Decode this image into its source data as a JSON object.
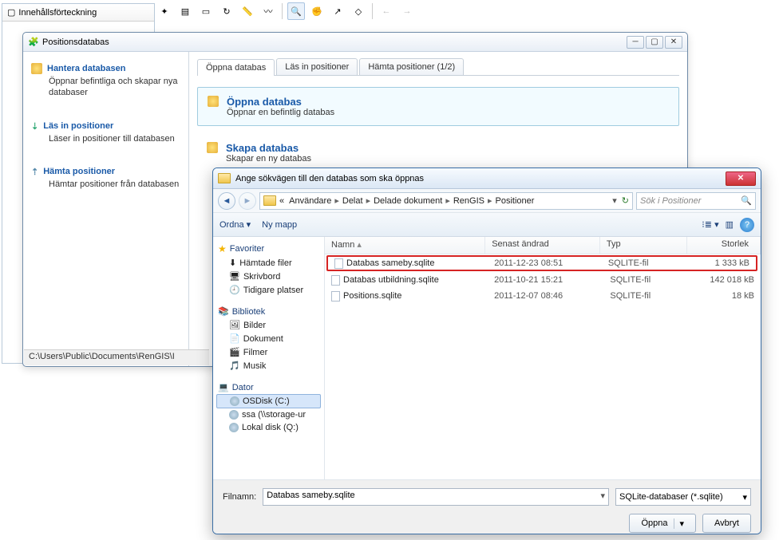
{
  "left_panel": {
    "tab": "Innehållsförteckning"
  },
  "pos_window": {
    "title": "Positionsdatabas",
    "status": "C:\\Users\\Public\\Documents\\RenGIS\\I",
    "sidebar": [
      {
        "title": "Hantera databasen",
        "desc": "Öppnar befintliga och skapar nya databaser"
      },
      {
        "title": "Läs in positioner",
        "desc": "Läser in positioner till databasen"
      },
      {
        "title": "Hämta positioner",
        "desc": "Hämtar positioner från databasen"
      }
    ],
    "tabs": [
      "Öppna databas",
      "Läs in positioner",
      "Hämta positioner (1/2)"
    ],
    "options": [
      {
        "title": "Öppna databas",
        "desc": "Öppnar en befintlig databas"
      },
      {
        "title": "Skapa databas",
        "desc": "Skapar en ny databas"
      }
    ]
  },
  "file_dialog": {
    "title": "Ange sökvägen till den databas som ska öppnas",
    "breadcrumb_prefix": "«",
    "breadcrumb": [
      "Användare",
      "Delat",
      "Delade dokument",
      "RenGIS",
      "Positioner"
    ],
    "search_placeholder": "Sök i Positioner",
    "toolbar": {
      "organize": "Ordna",
      "newfolder": "Ny mapp"
    },
    "tree": {
      "favorites": {
        "label": "Favoriter",
        "items": [
          "Hämtade filer",
          "Skrivbord",
          "Tidigare platser"
        ]
      },
      "library": {
        "label": "Bibliotek",
        "items": [
          "Bilder",
          "Dokument",
          "Filmer",
          "Musik"
        ]
      },
      "computer": {
        "label": "Dator",
        "items": [
          "OSDisk (C:)",
          "ssa (\\\\storage-ur",
          "Lokal disk (Q:)"
        ]
      }
    },
    "columns": [
      "Namn",
      "Senast ändrad",
      "Typ",
      "Storlek"
    ],
    "rows": [
      {
        "name": "Databas sameby.sqlite",
        "date": "2011-12-23 08:51",
        "type": "SQLITE-fil",
        "size": "1 333 kB",
        "hl": true
      },
      {
        "name": "Databas utbildning.sqlite",
        "date": "2011-10-21 15:21",
        "type": "SQLITE-fil",
        "size": "142 018 kB"
      },
      {
        "name": "Positions.sqlite",
        "date": "2011-12-07 08:46",
        "type": "SQLITE-fil",
        "size": "18 kB"
      }
    ],
    "filename_label": "Filnamn:",
    "filename_value": "Databas sameby.sqlite",
    "filter": "SQLite-databaser (*.sqlite)",
    "open": "Öppna",
    "cancel": "Avbryt"
  }
}
